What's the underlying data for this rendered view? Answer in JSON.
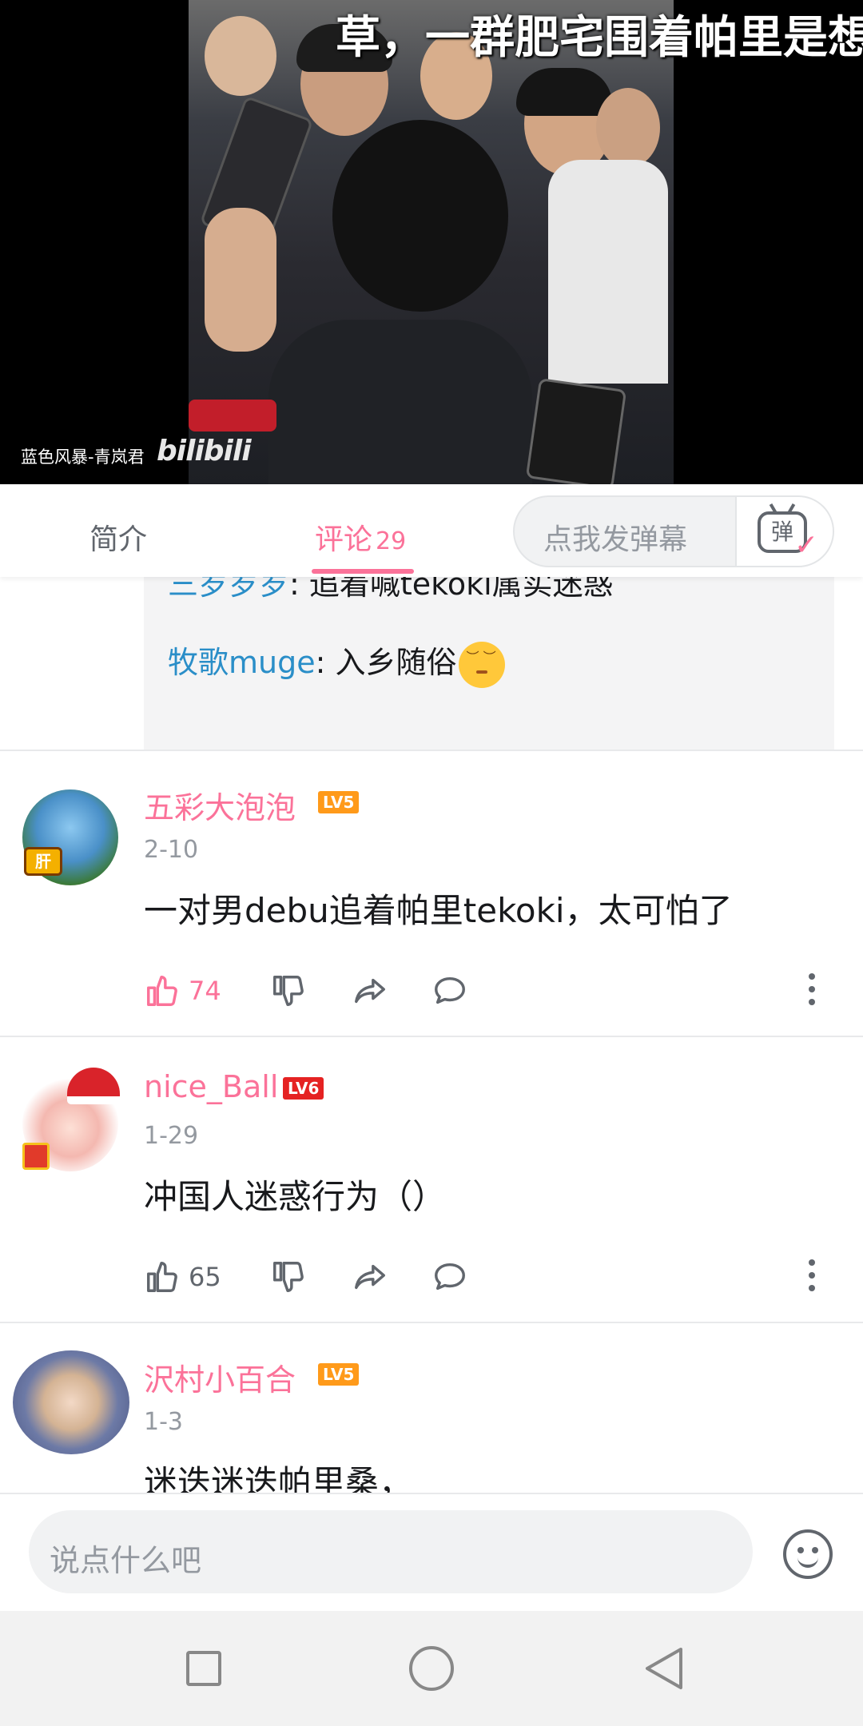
{
  "video": {
    "danmaku": "草，一群肥宅围着帕里是想怎么",
    "uploader": "蓝色风暴-青岚君",
    "logo": "bilibili"
  },
  "tabs": {
    "intro": "简介",
    "comments": "评论",
    "comment_count": "29",
    "danmu_placeholder": "点我发弹幕",
    "danmu_icon_char": "弹"
  },
  "sub_replies": [
    {
      "name": "三岁岁岁",
      "text": ": 追着喊tekoki属实迷惑"
    },
    {
      "name": "牧歌muge",
      "text": ": 入乡随俗"
    }
  ],
  "comments": [
    {
      "username": "五彩大泡泡",
      "level": "LV5",
      "date": "2-10",
      "text": "一对男debu追着帕里tekoki，太可怕了",
      "likes": "74"
    },
    {
      "username": "nice_Ball",
      "level": "LV6",
      "date": "1-29",
      "text": "冲国人迷惑行为（）",
      "likes": "65"
    },
    {
      "username": "沢村小百合",
      "level": "LV5",
      "date": "1-3",
      "text": "迷迭迷迭帕里桑，",
      "likes": ""
    }
  ],
  "input": {
    "placeholder": "说点什么吧"
  },
  "colors": {
    "accent": "#fb7299",
    "link": "#2a8ec8",
    "lv5": "#ff9a1a",
    "lv6": "#e52222"
  }
}
